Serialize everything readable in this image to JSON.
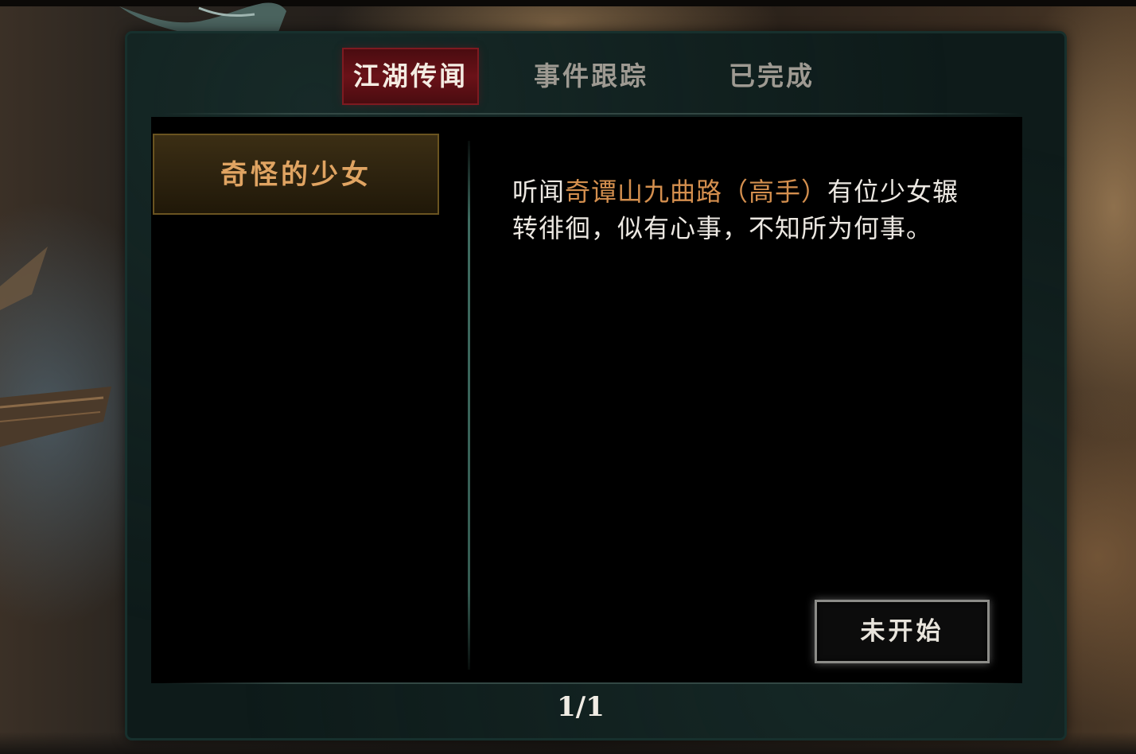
{
  "tabs": [
    {
      "label": "江湖传闻",
      "active": true
    },
    {
      "label": "事件跟踪",
      "active": false
    },
    {
      "label": "已完成",
      "active": false
    }
  ],
  "quest_list": [
    {
      "title": "奇怪的少女",
      "selected": true
    }
  ],
  "detail": {
    "text_prefix": "听闻",
    "location": "奇谭山九曲路（高手）",
    "text_suffix": "有位少女辗转徘徊，似有心事，不知所为何事。"
  },
  "status_button": {
    "label": "未开始"
  },
  "pagination": {
    "text": "1/1"
  },
  "colors": {
    "highlight": "#d48f4e",
    "active_tab": "#6a1218",
    "panel_bg": "#0e1b1a"
  }
}
